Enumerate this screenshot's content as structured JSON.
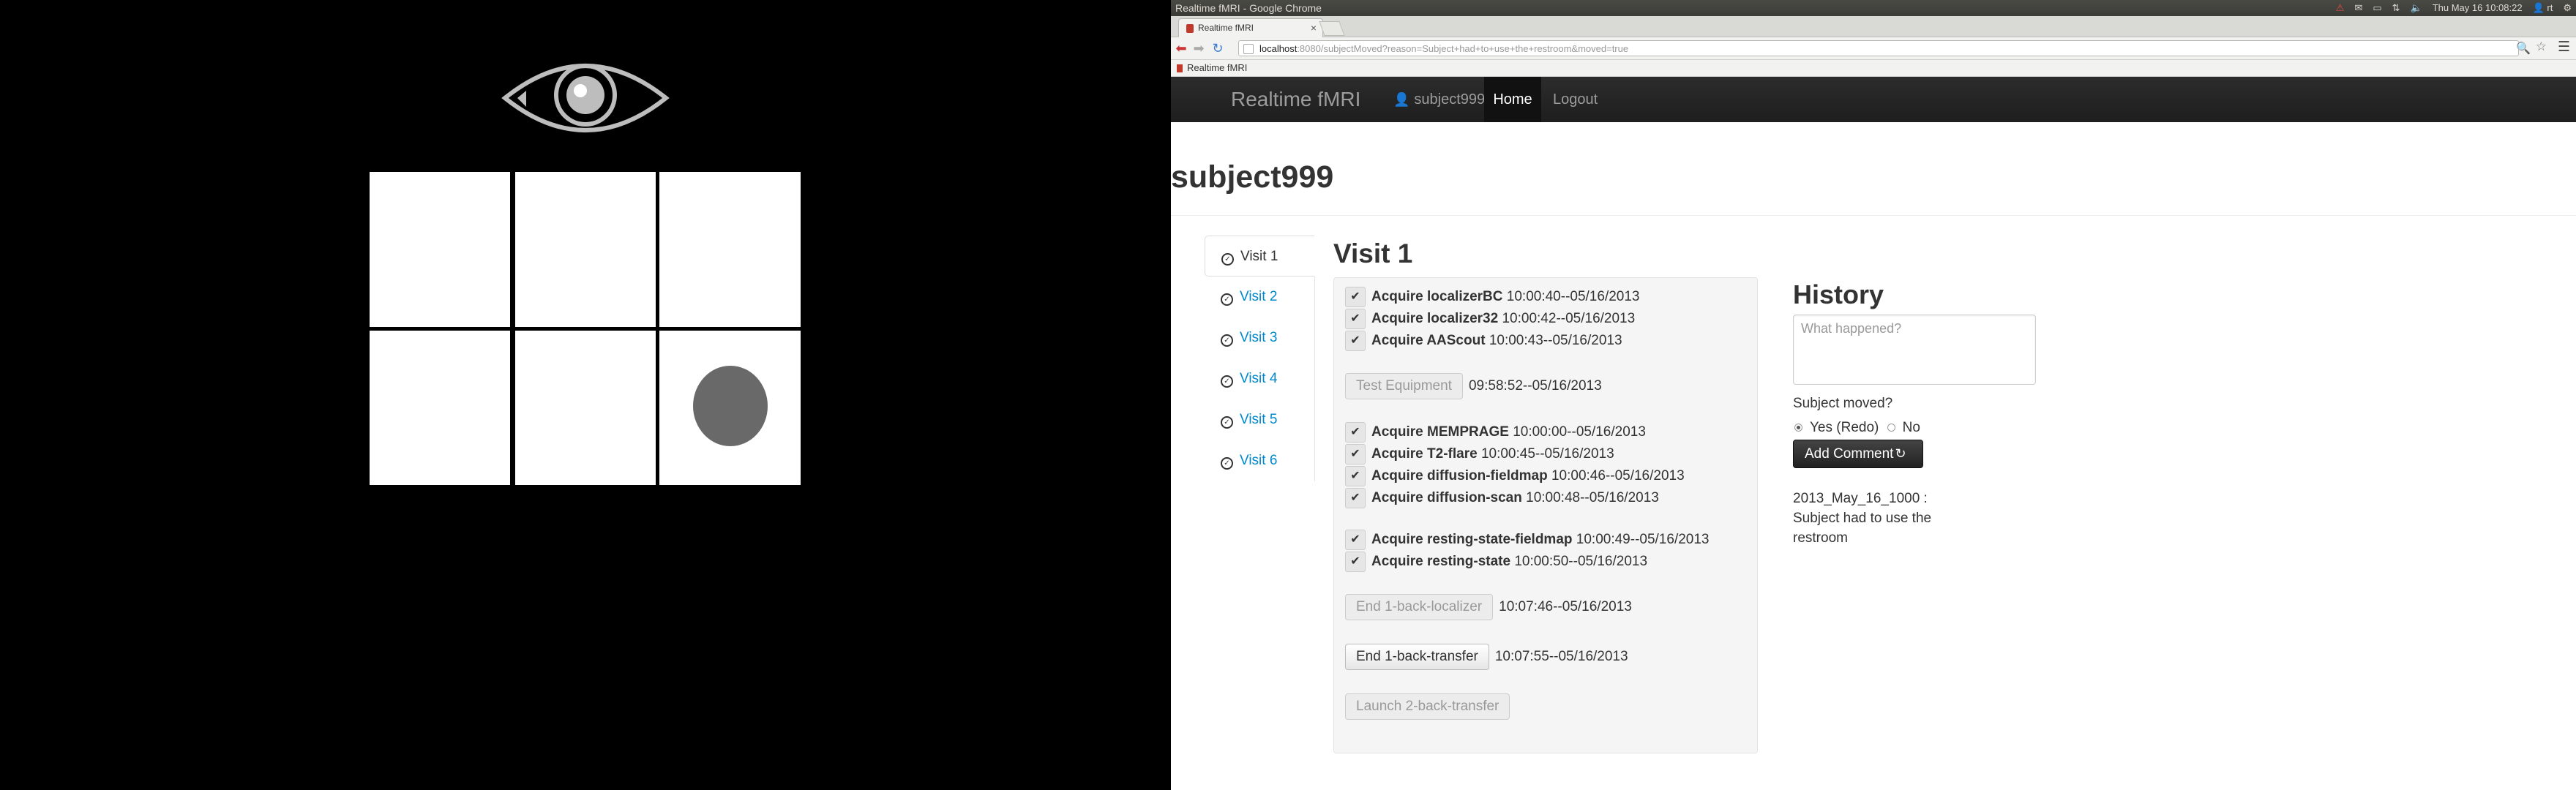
{
  "stimulus": {
    "grid": {
      "rows": 2,
      "cols": 3,
      "target_cell": 6
    }
  },
  "browser": {
    "window_title": "Realtime fMRI - Google Chrome",
    "tray_clock": "Thu May 16 10:08:22",
    "tray_user": "rt",
    "tab_title": "Realtime fMRI",
    "url_host": "localhost",
    "url_rest": ":8080/subjectMoved?reason=Subject+had+to+use+the+restroom&moved=true",
    "bookmark_label": "Realtime fMRI"
  },
  "navbar": {
    "brand": "Realtime fMRI",
    "user": "subject999",
    "home": "Home",
    "logout": "Logout"
  },
  "page_title": "subject999",
  "visits": [
    "Visit 1",
    "Visit 2",
    "Visit 3",
    "Visit 4",
    "Visit 5",
    "Visit 6"
  ],
  "visit_heading": "Visit 1",
  "steps": [
    {
      "name": "Acquire localizerBC",
      "time": "10:00:40--05/16/2013"
    },
    {
      "name": "Acquire localizer32",
      "time": "10:00:42--05/16/2013"
    },
    {
      "name": "Acquire AAScout",
      "time": "10:00:43--05/16/2013"
    },
    {
      "button": "Test Equipment",
      "time": "09:58:52--05/16/2013"
    },
    {
      "name": "Acquire MEMPRAGE",
      "time": "10:00:00--05/16/2013"
    },
    {
      "name": "Acquire T2-flare",
      "time": "10:00:45--05/16/2013"
    },
    {
      "name": "Acquire diffusion-fieldmap",
      "time": "10:00:46--05/16/2013"
    },
    {
      "name": "Acquire diffusion-scan",
      "time": "10:00:48--05/16/2013"
    },
    {
      "name": "Acquire resting-state-fieldmap",
      "time": "10:00:49--05/16/2013"
    },
    {
      "name": "Acquire resting-state",
      "time": "10:00:50--05/16/2013"
    },
    {
      "button": "End 1-back-localizer",
      "time": "10:07:46--05/16/2013"
    },
    {
      "button": "End 1-back-transfer",
      "time": "10:07:55--05/16/2013"
    },
    {
      "button": "Launch 2-back-transfer",
      "time": ""
    }
  ],
  "history": {
    "heading": "History",
    "placeholder": "What happened?",
    "moved_question": "Subject moved?",
    "yes_label": "Yes (Redo)",
    "no_label": "No",
    "add_comment": "Add Comment",
    "entry": "2013_May_16_1000 : Subject had to use the restroom"
  }
}
